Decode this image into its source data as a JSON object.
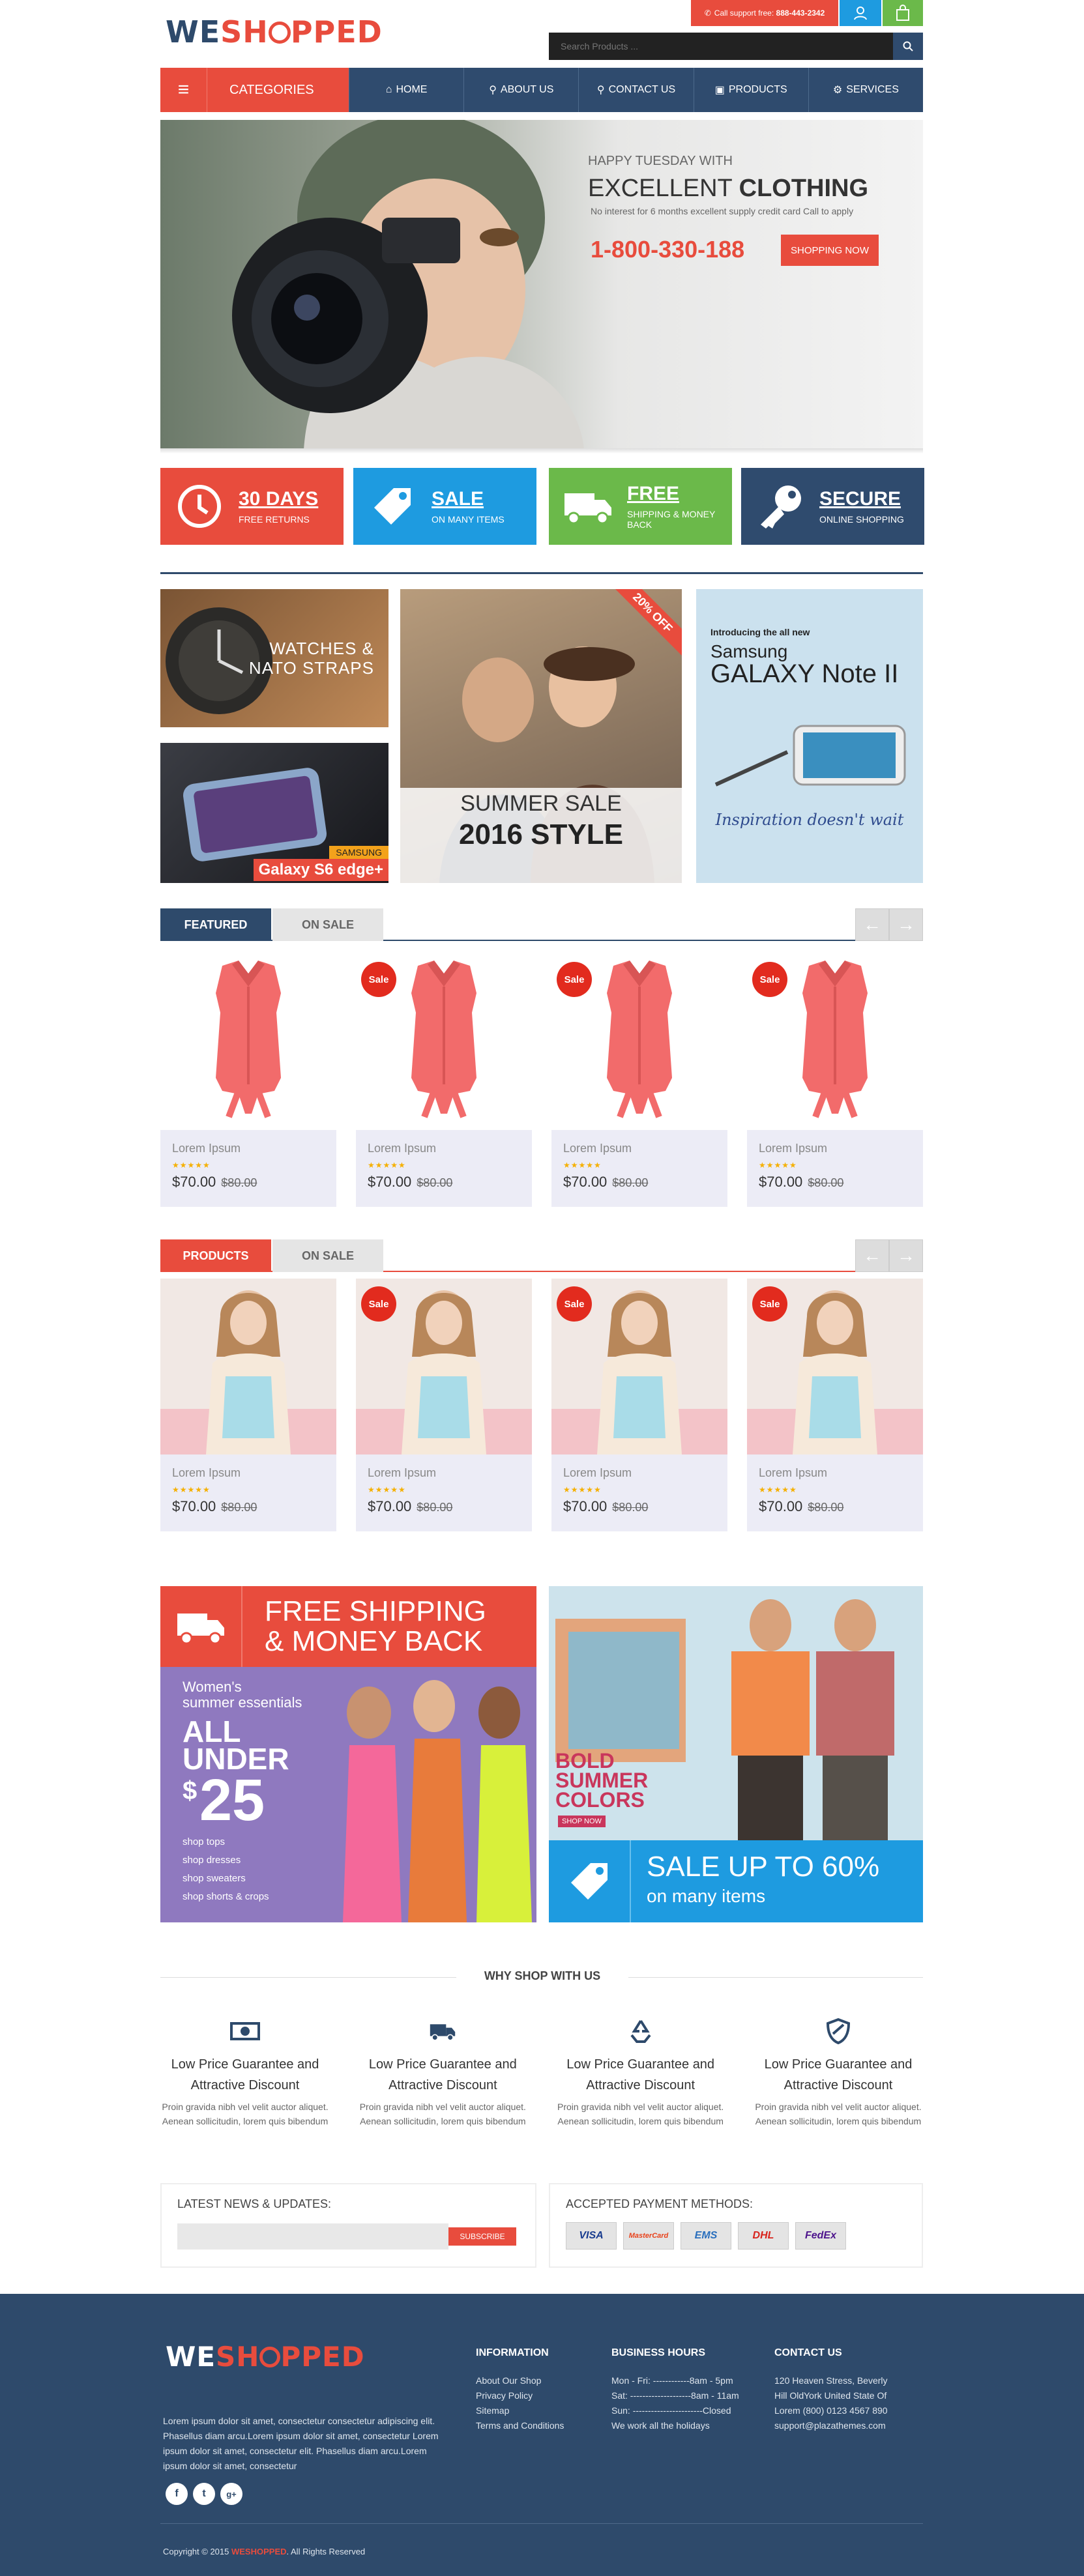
{
  "header": {
    "logo_a": "WE",
    "logo_b": "SH",
    "logo_c": "PPED",
    "logo_o": "O",
    "support": "Call support free:",
    "support_num": "888-443-2342",
    "search_placeholder": "Search Products ..."
  },
  "nav": {
    "categories": "CATEGORIES",
    "items": [
      "HOME",
      "ABOUT US",
      "CONTACT US",
      "PRODUCTS",
      "SERVICES"
    ]
  },
  "hero": {
    "line1": "HAPPY TUESDAY WITH",
    "line2a": "EXCELLENT ",
    "line2b": "CLOTHING",
    "line3": "No interest for 6 months excellent supply credit card Call to apply",
    "phone": "1-800-330-188",
    "cta": "SHOPPING NOW"
  },
  "features": [
    {
      "title": "30 DAYS",
      "sub": "FREE RETURNS",
      "color": "#e84c3d",
      "icon": "clock-icon"
    },
    {
      "title": "SALE",
      "sub": "ON MANY ITEMS",
      "color": "#1e9be0",
      "icon": "tag-icon"
    },
    {
      "title": "FREE",
      "sub": "SHIPPING & MONEY BACK",
      "color": "#6bb94a",
      "icon": "truck-icon"
    },
    {
      "title": "SECURE",
      "sub": "ONLINE SHOPPING",
      "color": "#2f4b6e",
      "icon": "key-icon"
    }
  ],
  "promos": {
    "watch": "WATCHES &",
    "watch2": "NATO STRAPS",
    "samsung_tag": "SAMSUNG",
    "galaxy": "Galaxy S6 edge+",
    "off": "20% OFF",
    "summer": "SUMMER SALE",
    "year": "2016 STYLE",
    "note_intro": "Introducing the all new",
    "note_brand": "Samsung",
    "note_name": "GALAXY Note II",
    "note_tag": "Inspiration doesn't wait"
  },
  "tabs1": {
    "active": "FEATURED",
    "other": "ON SALE"
  },
  "tabs2": {
    "active": "PRODUCTS",
    "other": "ON SALE"
  },
  "products1": [
    {
      "name": "Lorem Ipsum",
      "stars": "★★★★★",
      "price": "$70.00",
      "old": "$80.00",
      "sale": ""
    },
    {
      "name": "Lorem Ipsum",
      "stars": "★★★★★",
      "price": "$70.00",
      "old": "$80.00",
      "sale": "Sale"
    },
    {
      "name": "Lorem Ipsum",
      "stars": "★★★★★",
      "price": "$70.00",
      "old": "$80.00",
      "sale": "Sale"
    },
    {
      "name": "Lorem Ipsum",
      "stars": "★★★★★",
      "price": "$70.00",
      "old": "$80.00",
      "sale": "Sale"
    }
  ],
  "products2": [
    {
      "name": "Lorem Ipsum",
      "stars": "★★★★★",
      "price": "$70.00",
      "old": "$80.00",
      "sale": ""
    },
    {
      "name": "Lorem Ipsum",
      "stars": "★★★★★",
      "price": "$70.00",
      "old": "$80.00",
      "sale": "Sale"
    },
    {
      "name": "Lorem Ipsum",
      "stars": "★★★★★",
      "price": "$70.00",
      "old": "$80.00",
      "sale": "Sale"
    },
    {
      "name": "Lorem Ipsum",
      "stars": "★★★★★",
      "price": "$70.00",
      "old": "$80.00",
      "sale": "Sale"
    }
  ],
  "banners": {
    "ship1": "FREE SHIPPING",
    "ship2": "& MONEY BACK",
    "women1": "Women's",
    "women2": "summer essentials",
    "all": "ALL",
    "under": "UNDER",
    "dollar": "$",
    "price": "25",
    "links": [
      "shop tops",
      "shop dresses",
      "shop sweaters",
      "shop shorts & crops"
    ],
    "bold1": "BOLD",
    "bold2": "SUMMER",
    "bold3": "COLORS",
    "shopnow": "SHOP NOW",
    "saleup": "SALE UP TO 60%",
    "many": "on many items"
  },
  "why": {
    "title": "WHY SHOP WITH US",
    "items": [
      {
        "h": "Low Price Guarantee and Attractive Discount",
        "d": "Proin gravida nibh vel velit auctor aliquet. Aenean sollicitudin, lorem quis bibendum",
        "icon": "money-icon"
      },
      {
        "h": "Low Price Guarantee and Attractive Discount",
        "d": "Proin gravida nibh vel velit auctor aliquet. Aenean sollicitudin, lorem quis bibendum",
        "icon": "truck-icon"
      },
      {
        "h": "Low Price Guarantee and Attractive Discount",
        "d": "Proin gravida nibh vel velit auctor aliquet. Aenean sollicitudin, lorem quis bibendum",
        "icon": "recycle-icon"
      },
      {
        "h": "Low Price Guarantee and Attractive Discount",
        "d": "Proin gravida nibh vel velit auctor aliquet. Aenean sollicitudin, lorem quis bibendum",
        "icon": "shield-icon"
      }
    ]
  },
  "news": {
    "title": "LATEST NEWS & UPDATES:",
    "button": "SUBSCRIBE"
  },
  "payment": {
    "title": "ACCEPTED PAYMENT METHODS:",
    "methods": [
      "VISA",
      "MasterCard",
      "EMS",
      "DHL",
      "FedEx"
    ]
  },
  "footer": {
    "about": "Lorem ipsum dolor sit amet, consectetur consectetur adipiscing elit. Phasellus diam arcu.Lorem ipsum dolor sit amet, consectetur Lorem ipsum dolor sit amet, consectetur elit. Phasellus diam arcu.Lorem ipsum dolor sit amet, consectetur",
    "info_title": "INFORMATION",
    "info": [
      "About Our Shop",
      "Privacy Policy",
      "Sitemap",
      "Terms and Conditions"
    ],
    "hours_title": "BUSINESS HOURS",
    "hours": [
      "Mon - Fri: ------------8am - 5pm",
      "Sat: --------------------8am - 11am",
      "Sun: -----------------------Closed",
      "We work all the holidays"
    ],
    "contact_title": "CONTACT US",
    "contact": [
      "120 Heaven Stress, Beverly",
      "Hill OldYork United State Of",
      "Lorem (800) 0123 4567 890",
      "support@plazathemes.com"
    ],
    "copy_a": "Copyright © 2015 ",
    "copy_b": "WESHOPPED",
    "copy_c": ". All Rights Reserved"
  },
  "colors": {
    "red": "#e84c3d",
    "navy": "#2e4a6b",
    "blue": "#1e9be0",
    "green": "#6bb94a"
  }
}
